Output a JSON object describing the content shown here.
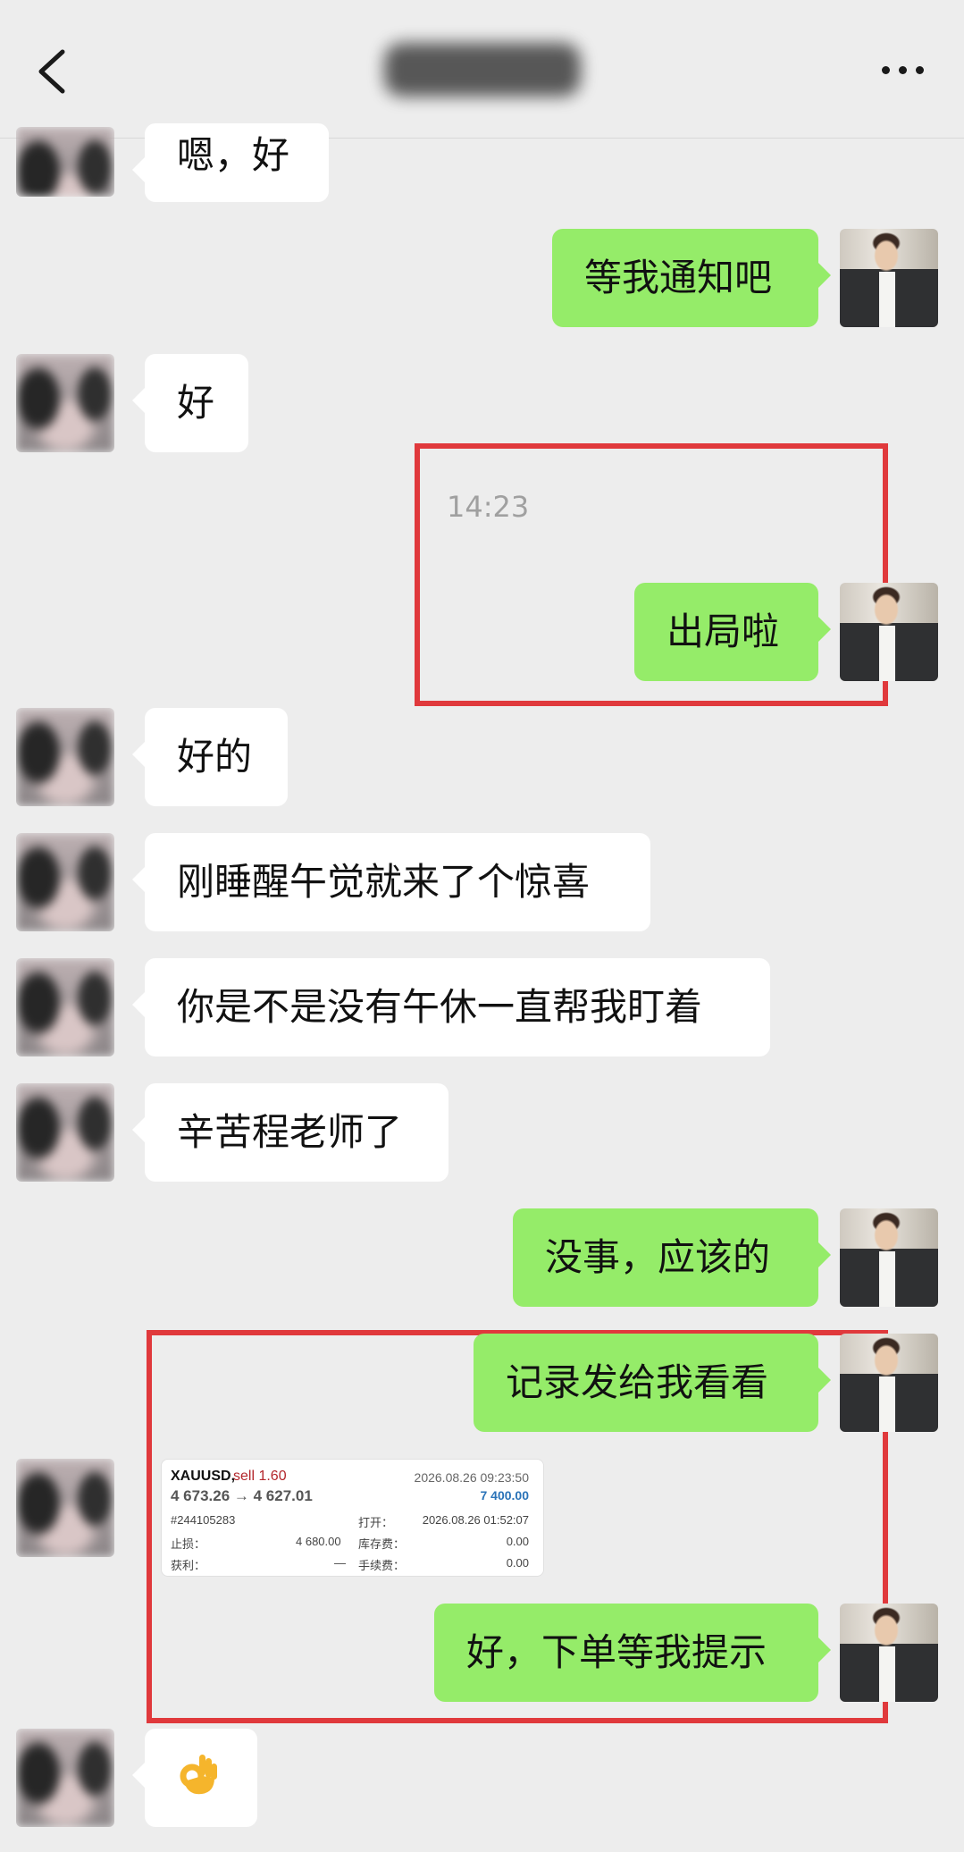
{
  "header": {
    "title": "",
    "back_icon": "chevron-left-icon",
    "more_icon": "more-horizontal-icon"
  },
  "messages": {
    "m1": "嗯，好",
    "m2": "等我通知吧",
    "m3": "好",
    "time": "14:23",
    "m4": "出局啦",
    "m5": "好的",
    "m6": "刚睡醒午觉就来了个惊喜",
    "m7": "你是不是没有午休一直帮我盯着",
    "m8": "辛苦程老师了",
    "m9": "没事，应该的",
    "m10": "记录发给我看看",
    "m11": "好，下单等我提示",
    "m12_emoji": "ok-hand-emoji"
  },
  "trade_card": {
    "symbol": "XAUUSD,",
    "side": "sell 1.60",
    "prices": "4 673.26 → 4 627.01",
    "close_time": "2026.08.26 09:23:50",
    "profit": "7 400.00",
    "order_id": "#244105283",
    "open_label": "打开：",
    "open_time": "2026.08.26 01:52:07",
    "sl_label": "止损：",
    "sl_value": "4 680.00",
    "swap_label": "库存费：",
    "swap_value": "0.00",
    "tp_label": "获利：",
    "tp_value": "—",
    "fee_label": "手续费：",
    "fee_value": "0.00"
  },
  "colors": {
    "background": "#ededed",
    "outgoing_bubble": "#95ec69",
    "incoming_bubble": "#ffffff",
    "highlight_box": "#e0393c"
  }
}
